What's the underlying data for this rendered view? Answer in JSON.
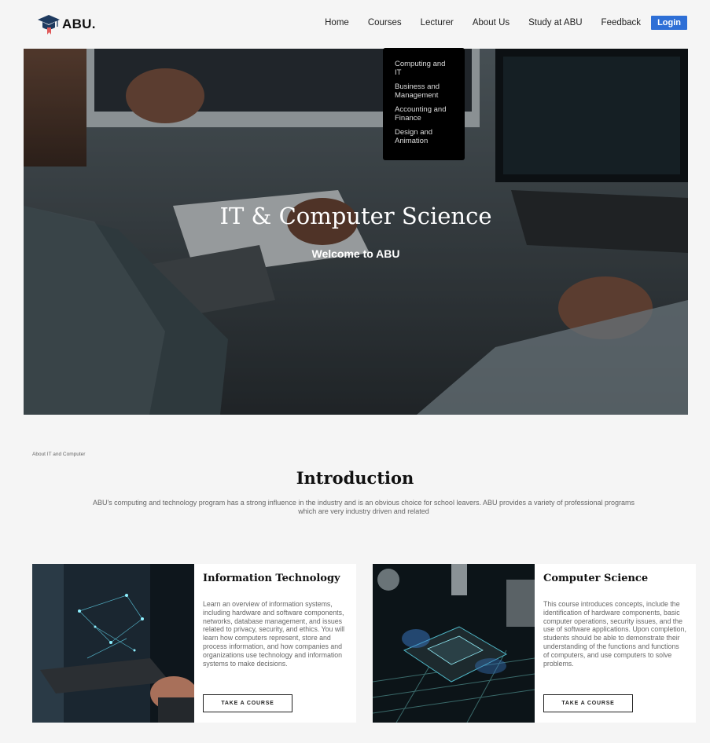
{
  "header": {
    "logo_text": "ABU.",
    "logo_icon": "graduation-cap-icon",
    "nav": [
      "Home",
      "Courses",
      "Lecturer",
      "About Us",
      "Study at ABU",
      "Feedback"
    ],
    "login_label": "Login"
  },
  "dropdown": {
    "items": [
      "Computing and IT",
      "Business and Management",
      "Accounting and Finance",
      "Design and Animation"
    ]
  },
  "hero": {
    "title": "IT & Computer Science",
    "subtitle": "Welcome to ABU"
  },
  "intro": {
    "breadcrumb": "About IT and Computer",
    "title": "Introduction",
    "text": "ABU's computing and technology program has a strong influence in the industry and is an obvious choice for school leavers. ABU provides a variety of professional programs which are very industry driven and related"
  },
  "cards": [
    {
      "title": "Information Technology",
      "text": "Learn an overview of information systems, including hardware and software components, networks, database management, and issues related to privacy, security, and ethics. You will learn how computers represent, store and process information, and how companies and organizations use technology and information systems to make decisions.",
      "button": "TAKE A COURSE"
    },
    {
      "title": "Computer Science",
      "text": "This course introduces concepts, include the identification of hardware components, basic computer operations, security issues, and the use of software applications. Upon completion, students should be able to demonstrate their understanding of the functions and functions of computers, and use computers to solve problems.",
      "button": "TAKE A COURSE"
    }
  ],
  "colors": {
    "accent": "#2e6fd6",
    "background": "#f5f5f5",
    "dropdown_bg": "#000000"
  }
}
